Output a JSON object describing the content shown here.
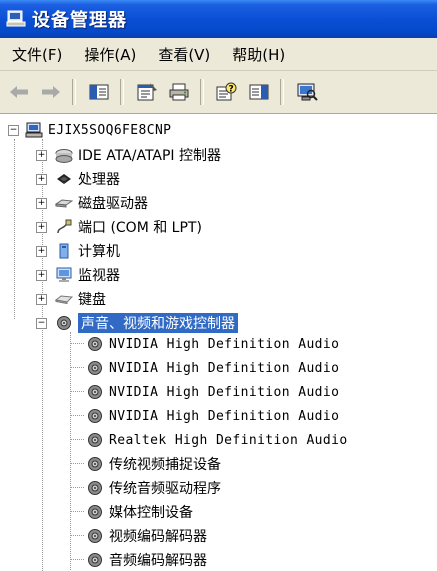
{
  "window": {
    "title": "设备管理器"
  },
  "menu": [
    {
      "label": "文件(F)"
    },
    {
      "label": "操作(A)"
    },
    {
      "label": "查看(V)"
    },
    {
      "label": "帮助(H)"
    }
  ],
  "toolbar": {
    "icons": [
      "back-arrow-icon",
      "forward-arrow-icon",
      "show-hide-console-tree-icon",
      "properties-icon",
      "print-icon",
      "help-icon",
      "show-hide-action-pane-icon",
      "scan-hardware-icon"
    ]
  },
  "tree": {
    "root": "EJIX5SOQ6FE8CNP",
    "categories": [
      {
        "label": "IDE ATA/ATAPI 控制器",
        "icon": "ide-controller-icon"
      },
      {
        "label": "处理器",
        "icon": "processor-icon"
      },
      {
        "label": "磁盘驱动器",
        "icon": "disk-drive-icon"
      },
      {
        "label": "端口 (COM 和 LPT)",
        "icon": "port-icon"
      },
      {
        "label": "计算机",
        "icon": "computer-icon"
      },
      {
        "label": "监视器",
        "icon": "monitor-icon"
      },
      {
        "label": "键盘",
        "icon": "keyboard-icon"
      }
    ],
    "expanded": {
      "label": "声音、视频和游戏控制器",
      "icon": "sound-video-game-icon"
    },
    "children": [
      {
        "label": "NVIDIA High Definition Audio"
      },
      {
        "label": "NVIDIA High Definition Audio"
      },
      {
        "label": "NVIDIA High Definition Audio"
      },
      {
        "label": "NVIDIA High Definition Audio"
      },
      {
        "label": "Realtek High Definition Audio"
      },
      {
        "label": "传统视频捕捉设备"
      },
      {
        "label": "传统音频驱动程序"
      },
      {
        "label": "媒体控制设备"
      },
      {
        "label": "视频编码解码器"
      },
      {
        "label": "音频编码解码器"
      }
    ]
  }
}
